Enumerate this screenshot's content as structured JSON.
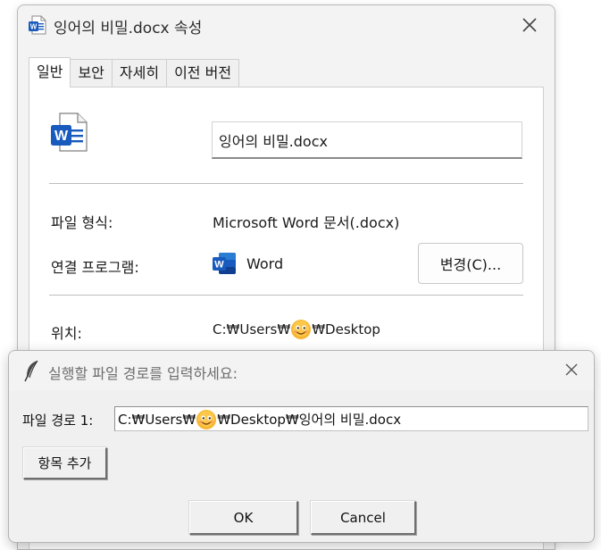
{
  "props": {
    "title": "잉어의 비밀.docx 속성",
    "tabs": [
      {
        "label": "일반",
        "active": true
      },
      {
        "label": "보안",
        "active": false
      },
      {
        "label": "자세히",
        "active": false
      },
      {
        "label": "이전 버전",
        "active": false
      }
    ],
    "file_name": "잉어의 비밀.docx",
    "file_type_label": "파일 형식:",
    "file_type_value": "Microsoft Word 문서(.docx)",
    "open_with_label": "연결 프로그램:",
    "open_with_app": "Word",
    "change_button": "변경(C)...",
    "location_label": "위치:",
    "location_prefix": "C:₩Users₩",
    "location_suffix": "₩Desktop"
  },
  "dialog": {
    "title": "실행할 파일 경로를 입력하세요:",
    "path_label": "파일 경로 1:",
    "path_prefix": "C:₩Users₩",
    "path_suffix": "₩Desktop₩잉어의 비밀.docx",
    "add_button": "항목 추가",
    "ok_button": "OK",
    "cancel_button": "Cancel"
  },
  "icons": {
    "word": "word-document-icon",
    "emoji": "smiling-face-emoji",
    "feather": "feather-icon",
    "close": "close-icon"
  },
  "colors": {
    "word_blue": "#185abd",
    "emoji_yellow": "#f7b531"
  }
}
